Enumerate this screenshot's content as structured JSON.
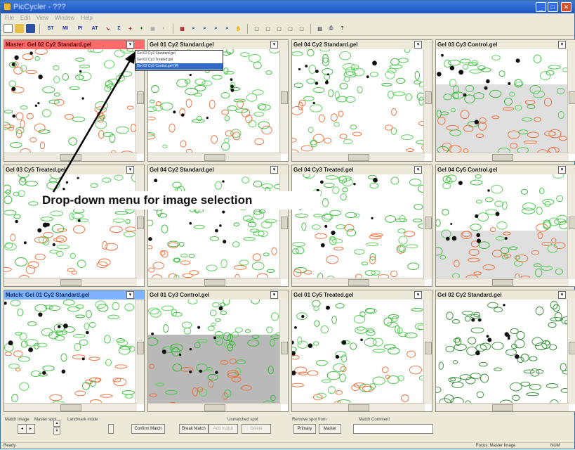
{
  "window": {
    "title": "PicCycler - ???",
    "controls": {
      "minimize": "_",
      "maximize": "□",
      "close": "✕"
    }
  },
  "menubar": {
    "items": [
      "File",
      "Edit",
      "View",
      "Window",
      "Help"
    ]
  },
  "toolbar": {
    "buttons": [
      "new",
      "open",
      "save",
      "ST",
      "MI",
      "PI",
      "AT"
    ]
  },
  "panels": [
    {
      "label": "Master: Gel 02 Cy2 Standard.gel",
      "role": "master"
    },
    {
      "label": "Gel 01 Cy2 Standard.gel",
      "role": "normal"
    },
    {
      "label": "Gel 04 Cy2 Standard.gel",
      "role": "normal"
    },
    {
      "label": "Gel 03 Cy3 Control.gel",
      "role": "normal"
    },
    {
      "label": "Gel 03 Cy5 Treated.gel",
      "role": "normal"
    },
    {
      "label": "Gel 04 Cy2 Standard.gel",
      "role": "normal"
    },
    {
      "label": "Gel 04 Cy3 Treated.gel",
      "role": "normal"
    },
    {
      "label": "Gel 04 Cy5 Control.gel",
      "role": "normal"
    },
    {
      "label": "Match: Gel 01 Cy2 Standard.gel",
      "role": "match"
    },
    {
      "label": "Gel 01 Cy3 Control.gel",
      "role": "normal"
    },
    {
      "label": "Gel 01 Cy5 Treated.gel",
      "role": "normal"
    },
    {
      "label": "Gel 02 Cy2 Standard.gel",
      "role": "normal"
    }
  ],
  "dropdown": {
    "options": [
      "Gel 02 Cy2 Standard.gel",
      "Gel 02 Cy3 Treated.gel",
      "Gel 02 Cy5 Control.gel (M)"
    ],
    "selected_index": 2
  },
  "callout": {
    "text": "Drop-down menu for image selection"
  },
  "bottom": {
    "match_image": "Match Image",
    "master_spot": "Master spot",
    "landmark_mode": "Landmark mode",
    "confirm_match": "Confirm Match",
    "break_match": "Break Match",
    "unmatched_spot": "Unmatched spot",
    "unmatched_btn1": "Add match",
    "unmatched_btn2": "Delete",
    "remove_spot_from": "Remove spot from",
    "primary": "Primary",
    "master": "Master",
    "match_comment": "Match Comment"
  },
  "status": {
    "left": "Ready",
    "focus": "Focus: Master Image",
    "num": "NUM"
  },
  "colors": {
    "master_header": "#ff6b6b",
    "match_header": "#7fb3ff",
    "spot_green": "#3cc83c",
    "spot_orange": "#f06a32"
  }
}
